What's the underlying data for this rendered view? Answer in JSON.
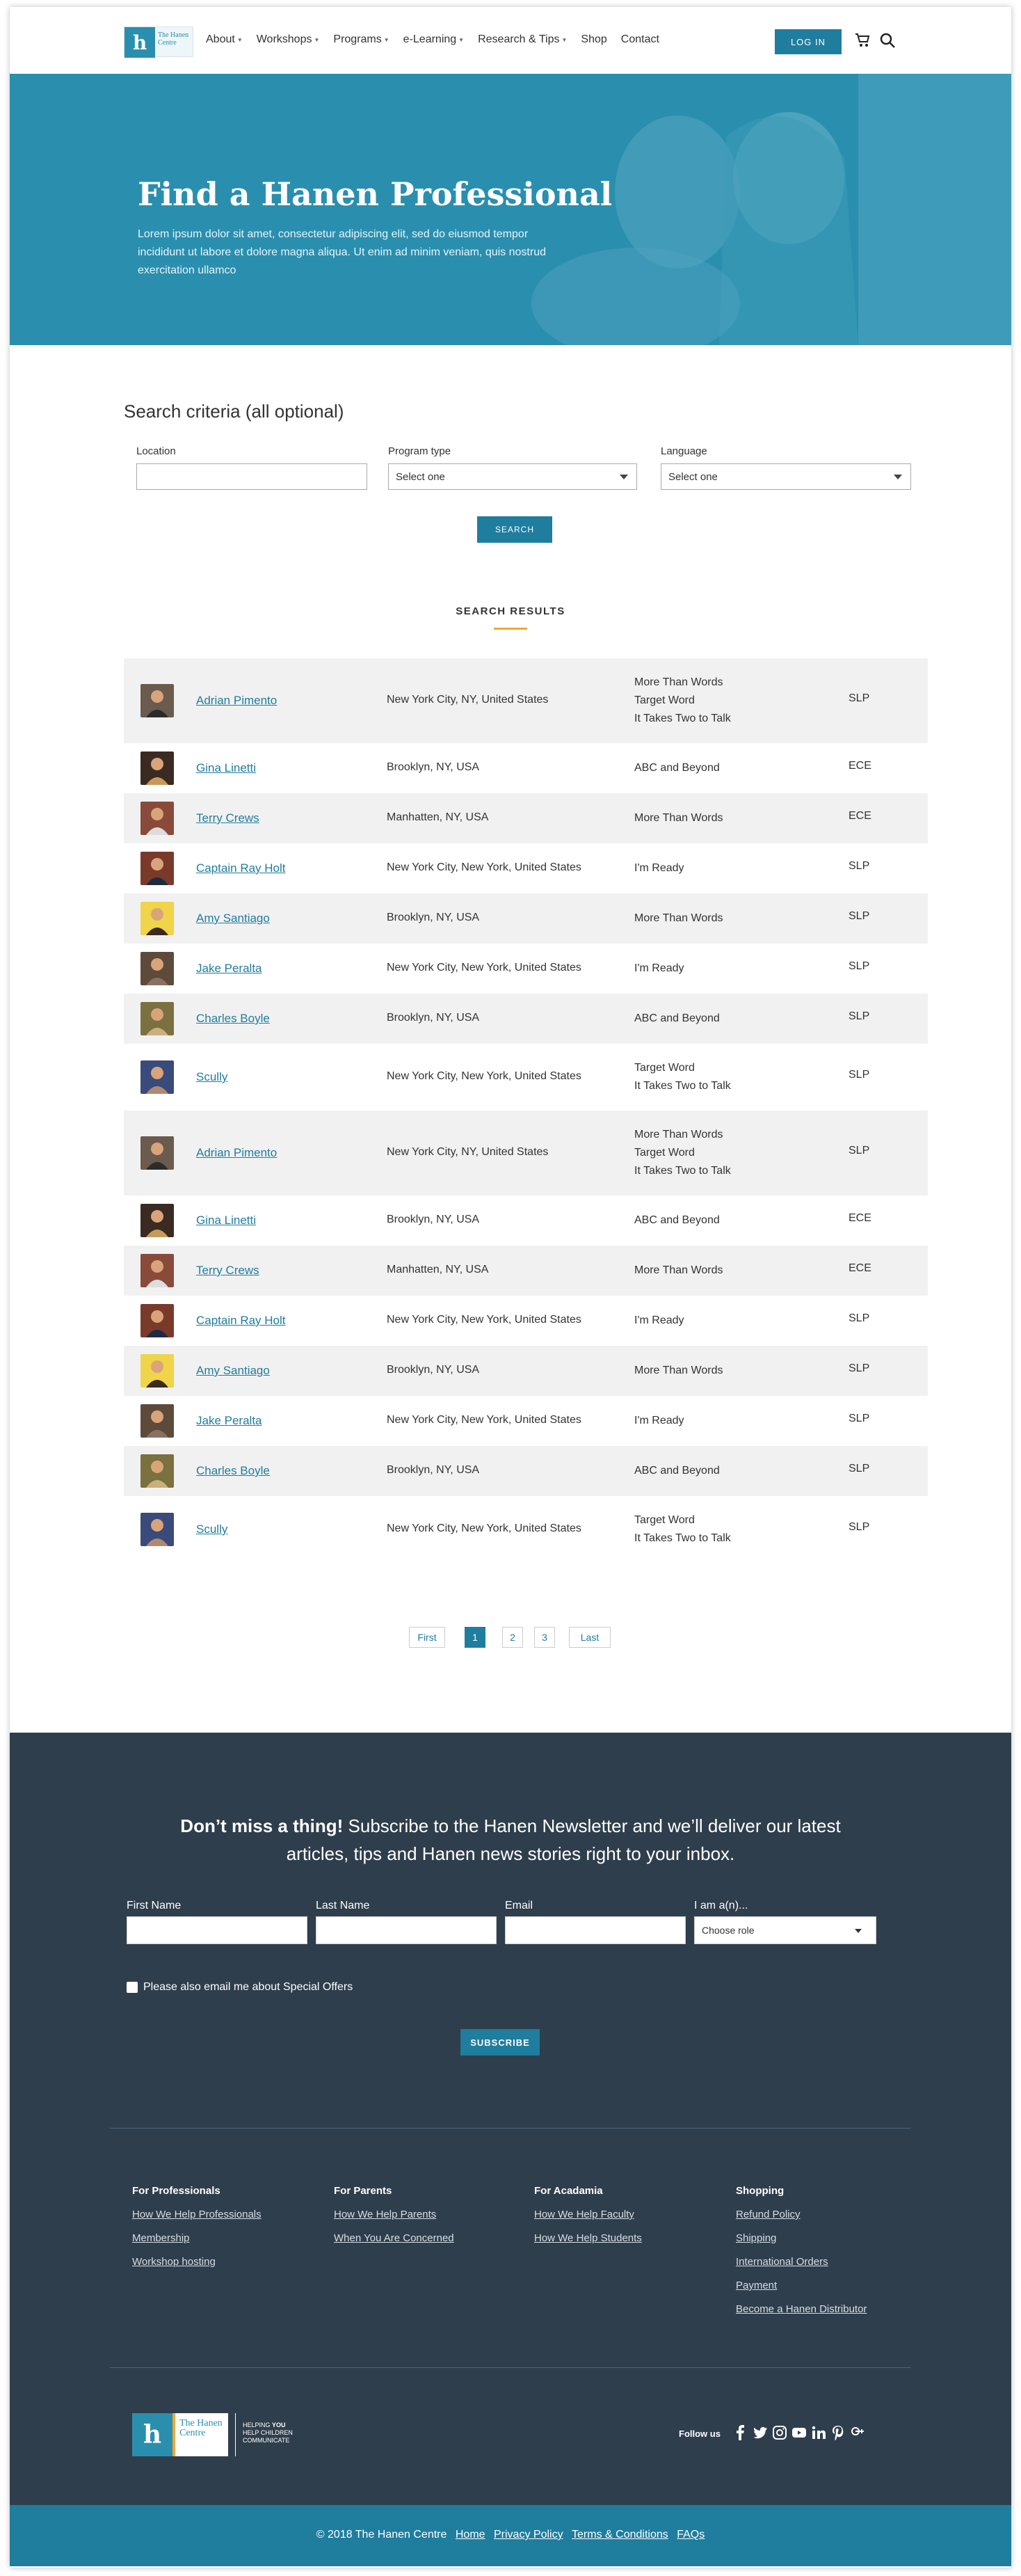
{
  "header": {
    "logo_text": "The Hanen Centre",
    "nav": [
      {
        "label": "About",
        "dropdown": true
      },
      {
        "label": "Workshops",
        "dropdown": true
      },
      {
        "label": "Programs",
        "dropdown": true
      },
      {
        "label": "e-Learning",
        "dropdown": true
      },
      {
        "label": "Research & Tips",
        "dropdown": true
      },
      {
        "label": "Shop",
        "dropdown": false
      },
      {
        "label": "Contact",
        "dropdown": false
      }
    ],
    "login_label": "LOG IN",
    "icons": {
      "cart": "cart-icon",
      "search": "search-icon"
    }
  },
  "hero": {
    "title": "Find a Hanen Professional",
    "text": "Lorem ipsum dolor sit amet, consectetur adipiscing elit, sed do eiusmod tempor incididunt ut labore et dolore magna aliqua. Ut enim ad minim veniam, quis nostrud exercitation ullamco"
  },
  "search": {
    "title": "Search criteria (all optional)",
    "location_label": "Location",
    "location_value": "",
    "program_label": "Program type",
    "program_value": "Select one",
    "language_label": "Language",
    "language_value": "Select one",
    "button_label": "SEARCH"
  },
  "results": {
    "heading": "SEARCH RESULTS",
    "rows": [
      {
        "name": "Adrian Pimento",
        "location": "New York City, NY, United States",
        "programs": [
          "More Than Words",
          "Target Word",
          "It Takes Two to Talk"
        ],
        "role": "SLP"
      },
      {
        "name": "Gina Linetti",
        "location": "Brooklyn, NY, USA",
        "programs": [
          "ABC and Beyond"
        ],
        "role": "ECE"
      },
      {
        "name": "Terry Crews",
        "location": "Manhatten, NY, USA",
        "programs": [
          "More Than Words"
        ],
        "role": "ECE"
      },
      {
        "name": "Captain Ray Holt",
        "location": "New York City, New York, United States",
        "programs": [
          "I'm Ready"
        ],
        "role": "SLP"
      },
      {
        "name": "Amy Santiago",
        "location": "Brooklyn, NY, USA",
        "programs": [
          "More Than Words"
        ],
        "role": "SLP"
      },
      {
        "name": "Jake Peralta",
        "location": "New York City, New York, United States",
        "programs": [
          "I'm Ready"
        ],
        "role": "SLP"
      },
      {
        "name": "Charles Boyle",
        "location": "Brooklyn, NY, USA",
        "programs": [
          "ABC and Beyond"
        ],
        "role": "SLP"
      },
      {
        "name": "Scully",
        "location": "New York City, New York, United States",
        "programs": [
          "Target Word",
          "It Takes Two to Talk"
        ],
        "role": "SLP"
      },
      {
        "name": "Adrian Pimento",
        "location": "New York City, NY, United States",
        "programs": [
          "More Than Words",
          "Target Word",
          "It Takes Two to Talk"
        ],
        "role": "SLP"
      },
      {
        "name": "Gina Linetti",
        "location": "Brooklyn, NY, USA",
        "programs": [
          "ABC and Beyond"
        ],
        "role": "ECE"
      },
      {
        "name": "Terry Crews",
        "location": "Manhatten, NY, USA",
        "programs": [
          "More Than Words"
        ],
        "role": "ECE"
      },
      {
        "name": "Captain Ray Holt",
        "location": "New York City, New York, United States",
        "programs": [
          "I'm Ready"
        ],
        "role": "SLP"
      },
      {
        "name": "Amy Santiago",
        "location": "Brooklyn, NY, USA",
        "programs": [
          "More Than Words"
        ],
        "role": "SLP"
      },
      {
        "name": "Jake Peralta",
        "location": "New York City, New York, United States",
        "programs": [
          "I'm Ready"
        ],
        "role": "SLP"
      },
      {
        "name": "Charles Boyle",
        "location": "Brooklyn, NY, USA",
        "programs": [
          "ABC and Beyond"
        ],
        "role": "SLP"
      },
      {
        "name": "Scully",
        "location": "New York City, New York, United States",
        "programs": [
          "Target Word",
          "It Takes Two to Talk"
        ],
        "role": "SLP"
      }
    ]
  },
  "pagination": {
    "first": "First",
    "pages": [
      "1",
      "2",
      "3"
    ],
    "current": "1",
    "last": "Last"
  },
  "newsletter": {
    "title_bold": "Don’t miss a thing!",
    "title_rest": "Subscribe to the Hanen Newsletter and we’ll deliver our latest articles, tips and Hanen news stories right to your inbox.",
    "first_name_label": "First Name",
    "last_name_label": "Last Name",
    "email_label": "Email",
    "role_label": "I am a(n)...",
    "role_value": "Choose role",
    "offers_label": "Please also email me about Special Offers",
    "subscribe_label": "SUBSCRIBE"
  },
  "footer": {
    "columns": [
      {
        "title": "For Professionals",
        "links": [
          "How We Help Professionals",
          "Membership",
          "Workshop hosting"
        ]
      },
      {
        "title": "For Parents",
        "links": [
          "How We Help Parents",
          "When You Are Concerned"
        ]
      },
      {
        "title": "For Acadamia",
        "links": [
          "How We Help Faculty",
          "How We Help Students"
        ]
      },
      {
        "title": "Shopping",
        "links": [
          "Refund Policy",
          "Shipping",
          "International Orders",
          "Payment",
          "Become a Hanen Distributor"
        ]
      }
    ],
    "logo_text": "The Hanen Centre",
    "tagline_1": "HELPING",
    "tagline_bold": "YOU",
    "tagline_2": "HELP CHILDREN",
    "tagline_3": "COMMUNICATE",
    "follow_label": "Follow us",
    "social": [
      "facebook-icon",
      "twitter-icon",
      "instagram-icon",
      "youtube-icon",
      "linkedin-icon",
      "pinterest-icon",
      "google-plus-icon"
    ],
    "copyright": "© 2018 The Hanen Centre",
    "bottom_links": [
      "Home",
      "Privacy Policy",
      "Terms & Conditions",
      "FAQs"
    ]
  },
  "colors": {
    "primary": "#1f7d9d",
    "hero": "#2a8fae",
    "footer_dark": "#2f3e4c",
    "accent": "#f0a830",
    "row_shade": "#f1f1f1"
  }
}
